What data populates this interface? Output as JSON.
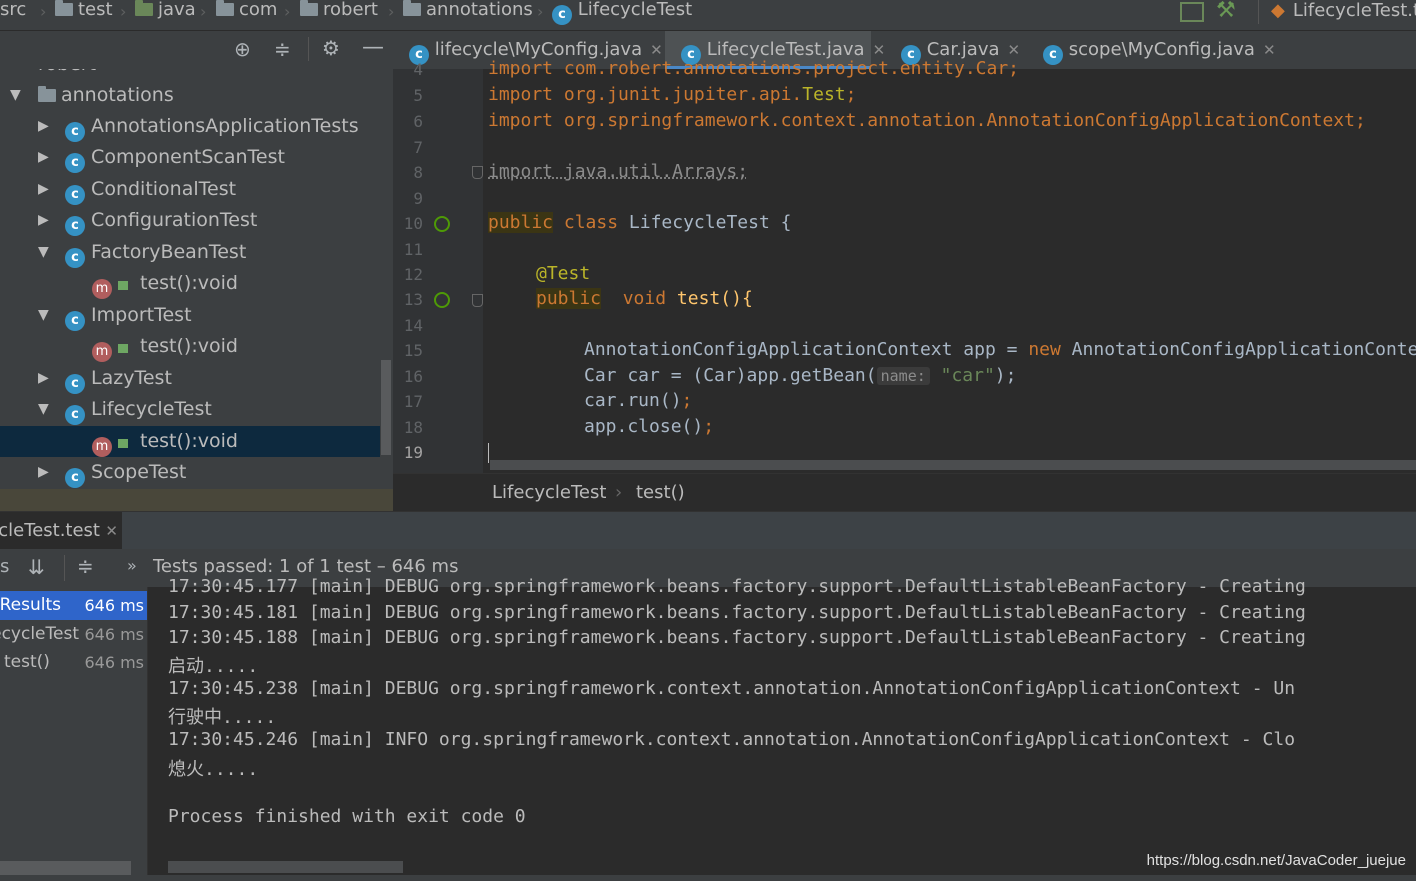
{
  "breadcrumb": {
    "items": [
      "src",
      "test",
      "java",
      "com",
      "robert",
      "annotations",
      "LifecycleTest"
    ],
    "run_config": "LifecycleTest.t"
  },
  "project_tree": {
    "partial_top": "robert",
    "items": [
      {
        "label": "annotations",
        "kind": "package",
        "expanded": true
      },
      {
        "label": "AnnotationsApplicationTests",
        "kind": "class",
        "expanded": false
      },
      {
        "label": "ComponentScanTest",
        "kind": "class",
        "expanded": false
      },
      {
        "label": "ConditionalTest",
        "kind": "class",
        "expanded": false
      },
      {
        "label": "ConfigurationTest",
        "kind": "class",
        "expanded": false
      },
      {
        "label": "FactoryBeanTest",
        "kind": "class",
        "expanded": true
      },
      {
        "label": "test():void",
        "kind": "method"
      },
      {
        "label": "ImportTest",
        "kind": "class",
        "expanded": true
      },
      {
        "label": "test():void",
        "kind": "method"
      },
      {
        "label": "LazyTest",
        "kind": "class",
        "expanded": false
      },
      {
        "label": "LifecycleTest",
        "kind": "class",
        "expanded": true
      },
      {
        "label": "test():void",
        "kind": "method",
        "selected": true
      },
      {
        "label": "ScopeTest",
        "kind": "class",
        "expanded": false
      }
    ]
  },
  "editor": {
    "tabs": [
      {
        "label": "lifecycle\\MyConfig.java",
        "active": false
      },
      {
        "label": "LifecycleTest.java",
        "active": true
      },
      {
        "label": "Car.java",
        "active": false
      },
      {
        "label": "scope\\MyConfig.java",
        "active": false
      }
    ],
    "line_numbers": [
      "4",
      "5",
      "6",
      "7",
      "8",
      "9",
      "10",
      "11",
      "12",
      "13",
      "14",
      "15",
      "16",
      "17",
      "18",
      "19"
    ],
    "code": {
      "l4": "import com.robert.annotations.project.entity.Car;",
      "l5_pre": "import org.junit.jupiter.api.",
      "l5_cls": "Test",
      "l5_semi": ";",
      "l6": "import org.springframework.context.annotation.AnnotationConfigApplicationContext;",
      "l8": "import java.util.Arrays;",
      "l10_public": "public",
      "l10_class": "class",
      "l10_rest": "LifecycleTest {",
      "l12": "@Test",
      "l13_public": "public",
      "l13_void": "void",
      "l13_rest": "test(){",
      "l15_pre": "AnnotationConfigApplicationContext app = ",
      "l15_new": "new",
      "l15_post": " AnnotationConfigApplicationContext",
      "l16_pre": "Car car = (Car)app.getBean(",
      "l16_hint": "name:",
      "l16_str": "\"car\"",
      "l16_post": ");",
      "l17_pre": "car.run()",
      "l17_semi": ";",
      "l18_pre": "app.close()",
      "l18_semi": ";"
    },
    "breadcrumb": [
      "LifecycleTest",
      "test()"
    ]
  },
  "run_panel": {
    "tab_label": "LifecycleTest.test",
    "status": "Tests passed: 1 of 1 test – 646 ms",
    "results": [
      {
        "label": "Test Results",
        "time": "646 ms",
        "selected": true
      },
      {
        "label": "LifecycleTest",
        "time": "646 ms",
        "selected": false
      },
      {
        "label": "test()",
        "time": "646 ms",
        "selected": false
      }
    ],
    "console_lines": [
      "17:30:45.177 [main] DEBUG org.springframework.beans.factory.support.DefaultListableBeanFactory - Creating",
      "17:30:45.181 [main] DEBUG org.springframework.beans.factory.support.DefaultListableBeanFactory - Creating",
      "17:30:45.188 [main] DEBUG org.springframework.beans.factory.support.DefaultListableBeanFactory - Creating",
      "启动.....",
      "17:30:45.238 [main] DEBUG org.springframework.context.annotation.AnnotationConfigApplicationContext - Un",
      "行驶中.....",
      "17:30:45.246 [main] INFO org.springframework.context.annotation.AnnotationConfigApplicationContext - Clo",
      "熄火.....",
      "",
      "Process finished with exit code 0"
    ]
  },
  "watermark": "https://blog.csdn.net/JavaCoder_juejue",
  "colors": {
    "background": "#2b2b2b",
    "panel": "#3c3f41",
    "keyword": "#cc7832",
    "annotation": "#bbb529",
    "string": "#6a8759",
    "selection": "#0d293e",
    "results_selection": "#2f65ca"
  }
}
